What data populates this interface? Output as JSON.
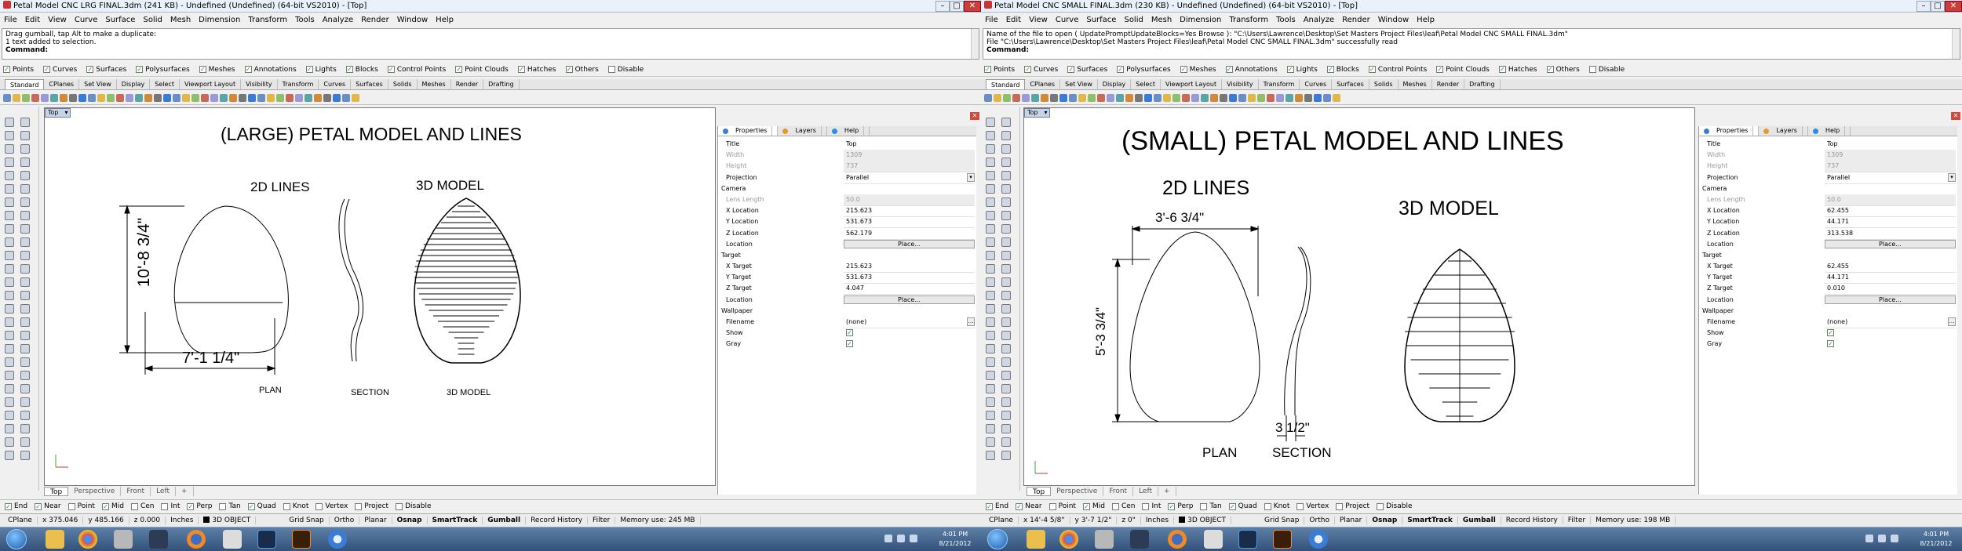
{
  "windows": [
    {
      "title": "Petal Model CNC LRG FINAL.3dm (241 KB) - Undefined (Undefined) (64-bit VS2010) - [Top]",
      "menu": [
        "File",
        "Edit",
        "View",
        "Curve",
        "Surface",
        "Solid",
        "Mesh",
        "Dimension",
        "Transform",
        "Tools",
        "Analyze",
        "Render",
        "Window",
        "Help"
      ],
      "command_history": [
        "Drag gumball, tap Alt to make a duplicate:",
        "1 text added to selection."
      ],
      "command_prompt": "Command:",
      "filters": [
        "Points",
        "Curves",
        "Surfaces",
        "Polysurfaces",
        "Meshes",
        "Annotations",
        "Lights",
        "Blocks",
        "Control Points",
        "Point Clouds",
        "Hatches",
        "Others",
        "Disable"
      ],
      "toolbar_tabs": [
        "Standard",
        "CPlanes",
        "Set View",
        "Display",
        "Select",
        "Viewport Layout",
        "Visibility",
        "Transform",
        "Curves",
        "Surfaces",
        "Solids",
        "Meshes",
        "Render",
        "Drafting"
      ],
      "viewport_name": "Top",
      "drawing": {
        "title": "(LARGE) PETAL MODEL AND LINES",
        "label_2d": "2D LINES",
        "label_3d": "3D MODEL",
        "dim_height": "10'-8 3/4\"",
        "dim_width": "7'-1 1/4\"",
        "caption_plan": "PLAN",
        "caption_section": "SECTION",
        "caption_3d": "3D MODEL"
      },
      "viewport_tabs": [
        "Top",
        "Perspective",
        "Front",
        "Left"
      ],
      "panel_tabs": [
        "Properties",
        "Layers",
        "Help"
      ],
      "properties": {
        "title_label": "Title",
        "title_value": "Top",
        "width_label": "Width",
        "width_value": "1309",
        "height_label": "Height",
        "height_value": "737",
        "projection_label": "Projection",
        "projection_value": "Parallel",
        "camera_section": "Camera",
        "lens_label": "Lens Length",
        "lens_value": "50.0",
        "xloc_label": "X Location",
        "xloc_value": "215.623",
        "yloc_label": "Y Location",
        "yloc_value": "531.673",
        "zloc_label": "Z Location",
        "zloc_value": "562.179",
        "location_label": "Location",
        "place_label": "Place...",
        "target_section": "Target",
        "xtar_label": "X Target",
        "xtar_value": "215.623",
        "ytar_label": "Y Target",
        "ytar_value": "531.673",
        "ztar_label": "Z Target",
        "ztar_value": "4.047",
        "tlocation_label": "Location",
        "tplace_label": "Place...",
        "wallpaper_section": "Wallpaper",
        "filename_label": "Filename",
        "filename_value": "(none)",
        "show_label": "Show",
        "gray_label": "Gray"
      },
      "osnaps": [
        "End",
        "Near",
        "Point",
        "Mid",
        "Cen",
        "Int",
        "Perp",
        "Tan",
        "Quad",
        "Knot",
        "Vertex",
        "Project",
        "Disable"
      ],
      "status": {
        "cplane": "CPlane",
        "x": "x 375.046",
        "y": "y 485.166",
        "z": "z 0.000",
        "units": "Inches",
        "layer": "3D OBJECT",
        "items": [
          "Grid Snap",
          "Ortho",
          "Planar",
          "Osnap",
          "SmartTrack",
          "Gumball",
          "Record History",
          "Filter"
        ],
        "memory": "Memory use: 245 MB"
      }
    },
    {
      "title": "Petal Model CNC SMALL FINAL.3dm (230 KB) - Undefined (Undefined) (64-bit VS2010) - [Top]",
      "menu": [
        "File",
        "Edit",
        "View",
        "Curve",
        "Surface",
        "Solid",
        "Mesh",
        "Dimension",
        "Transform",
        "Tools",
        "Analyze",
        "Render",
        "Window",
        "Help"
      ],
      "command_history": [
        "Name of the file to open ( UpdatePromptUpdateBlocks=Yes  Browse ): \"C:\\Users\\Lawrence\\Desktop\\Set Masters Project Files\\leaf\\Petal Model CNC SMALL FINAL.3dm\"",
        "File \"C:\\Users\\Lawrence\\Desktop\\Set Masters Project Files\\leaf\\Petal Model CNC SMALL FINAL.3dm\" successfully read"
      ],
      "command_prompt": "Command:",
      "filters": [
        "Points",
        "Curves",
        "Surfaces",
        "Polysurfaces",
        "Meshes",
        "Annotations",
        "Lights",
        "Blocks",
        "Control Points",
        "Point Clouds",
        "Hatches",
        "Others",
        "Disable"
      ],
      "toolbar_tabs": [
        "Standard",
        "CPlanes",
        "Set View",
        "Display",
        "Select",
        "Viewport Layout",
        "Visibility",
        "Transform",
        "Curves",
        "Surfaces",
        "Solids",
        "Meshes",
        "Render",
        "Drafting"
      ],
      "viewport_name": "Top",
      "drawing": {
        "title": "(SMALL) PETAL MODEL AND LINES",
        "label_2d": "2D LINES",
        "label_3d": "3D MODEL",
        "dim_height": "5'-3 3/4\"",
        "dim_width": "3'-6 3/4\"",
        "dim_section": "3 1/2\"",
        "caption_plan": "PLAN",
        "caption_section": "SECTION"
      },
      "viewport_tabs": [
        "Top",
        "Perspective",
        "Front",
        "Left"
      ],
      "panel_tabs": [
        "Properties",
        "Layers",
        "Help"
      ],
      "properties": {
        "title_label": "Title",
        "title_value": "Top",
        "width_label": "Width",
        "width_value": "1309",
        "height_label": "Height",
        "height_value": "737",
        "projection_label": "Projection",
        "projection_value": "Parallel",
        "camera_section": "Camera",
        "lens_label": "Lens Length",
        "lens_value": "50.0",
        "xloc_label": "X Location",
        "xloc_value": "62.455",
        "yloc_label": "Y Location",
        "yloc_value": "44.171",
        "zloc_label": "Z Location",
        "zloc_value": "313.538",
        "location_label": "Location",
        "place_label": "Place...",
        "target_section": "Target",
        "xtar_label": "X Target",
        "xtar_value": "62.455",
        "ytar_label": "Y Target",
        "ytar_value": "44.171",
        "ztar_label": "Z Target",
        "ztar_value": "0.010",
        "tlocation_label": "Location",
        "tplace_label": "Place...",
        "wallpaper_section": "Wallpaper",
        "filename_label": "Filename",
        "filename_value": "(none)",
        "show_label": "Show",
        "gray_label": "Gray"
      },
      "osnaps": [
        "End",
        "Near",
        "Point",
        "Mid",
        "Cen",
        "Int",
        "Perp",
        "Tan",
        "Quad",
        "Knot",
        "Vertex",
        "Project",
        "Disable"
      ],
      "status": {
        "cplane": "CPlane",
        "x": "x 14'-4 5/8\"",
        "y": "y 3'-7 1/2\"",
        "z": "z 0\"",
        "units": "Inches",
        "layer": "3D OBJECT",
        "items": [
          "Grid Snap",
          "Ortho",
          "Planar",
          "Osnap",
          "SmartTrack",
          "Gumball",
          "Record History",
          "Filter"
        ],
        "memory": "Memory use: 198 MB"
      }
    }
  ],
  "taskbar": {
    "apps": [
      "windows-explorer",
      "chrome",
      "file-manager",
      "powerpoint",
      "firefox",
      "tool",
      "photoshop",
      "illustrator",
      "itunes"
    ],
    "left_clock": {
      "time": "4:01 PM",
      "date": "8/21/2012"
    },
    "right_clock": {
      "time": "4:01 PM",
      "date": "8/21/2012"
    }
  },
  "colors": {
    "accent": "#33527b",
    "titlebar": "#eaf1fb",
    "close": "#c9403a",
    "viewport_label": "#c8d4e6"
  }
}
